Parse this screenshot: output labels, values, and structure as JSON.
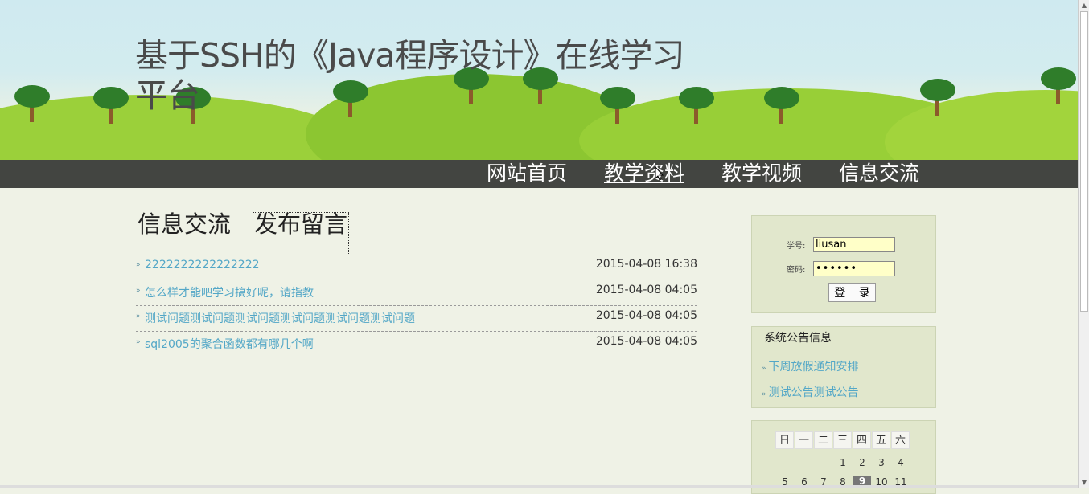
{
  "header": {
    "title": "基于SSH的《Java程序设计》在线学习平台"
  },
  "nav": {
    "items": [
      {
        "label": "网站首页"
      },
      {
        "label": "教学资料"
      },
      {
        "label": "教学视频"
      },
      {
        "label": "信息交流"
      }
    ]
  },
  "main": {
    "tabs": [
      {
        "label": "信息交流"
      },
      {
        "label": "发布留言"
      }
    ],
    "messages": [
      {
        "title": "2222222222222222",
        "date": "2015-04-08 16:38"
      },
      {
        "title": "怎么样才能吧学习搞好呢，请指教",
        "date": "2015-04-08 04:05"
      },
      {
        "title": "测试问题测试问题测试问题测试问题测试问题测试问题",
        "date": "2015-04-08 04:05"
      },
      {
        "title": "sql2005的聚合函数都有哪几个啊",
        "date": "2015-04-08 04:05"
      }
    ]
  },
  "login": {
    "student_label": "学号:",
    "password_label": "密码:",
    "student_value": "liusan",
    "password_value": "••••••",
    "button_label": "登 录"
  },
  "notices": {
    "heading": "系统公告信息",
    "items": [
      {
        "label": "下周放假通知安排"
      },
      {
        "label": "测试公告测试公告"
      }
    ]
  },
  "calendar": {
    "weekdays": [
      "日",
      "一",
      "二",
      "三",
      "四",
      "五",
      "六"
    ],
    "week1": [
      "1",
      "2",
      "3",
      "4"
    ],
    "week2": [
      "5",
      "6",
      "7",
      "8",
      "9",
      "10",
      "11"
    ],
    "today": "9"
  },
  "colors": {
    "nav_bg": "#434541",
    "link": "#53a7c7",
    "page_bg": "#eff2e6",
    "sidebar_bg": "#e1e7cc"
  }
}
